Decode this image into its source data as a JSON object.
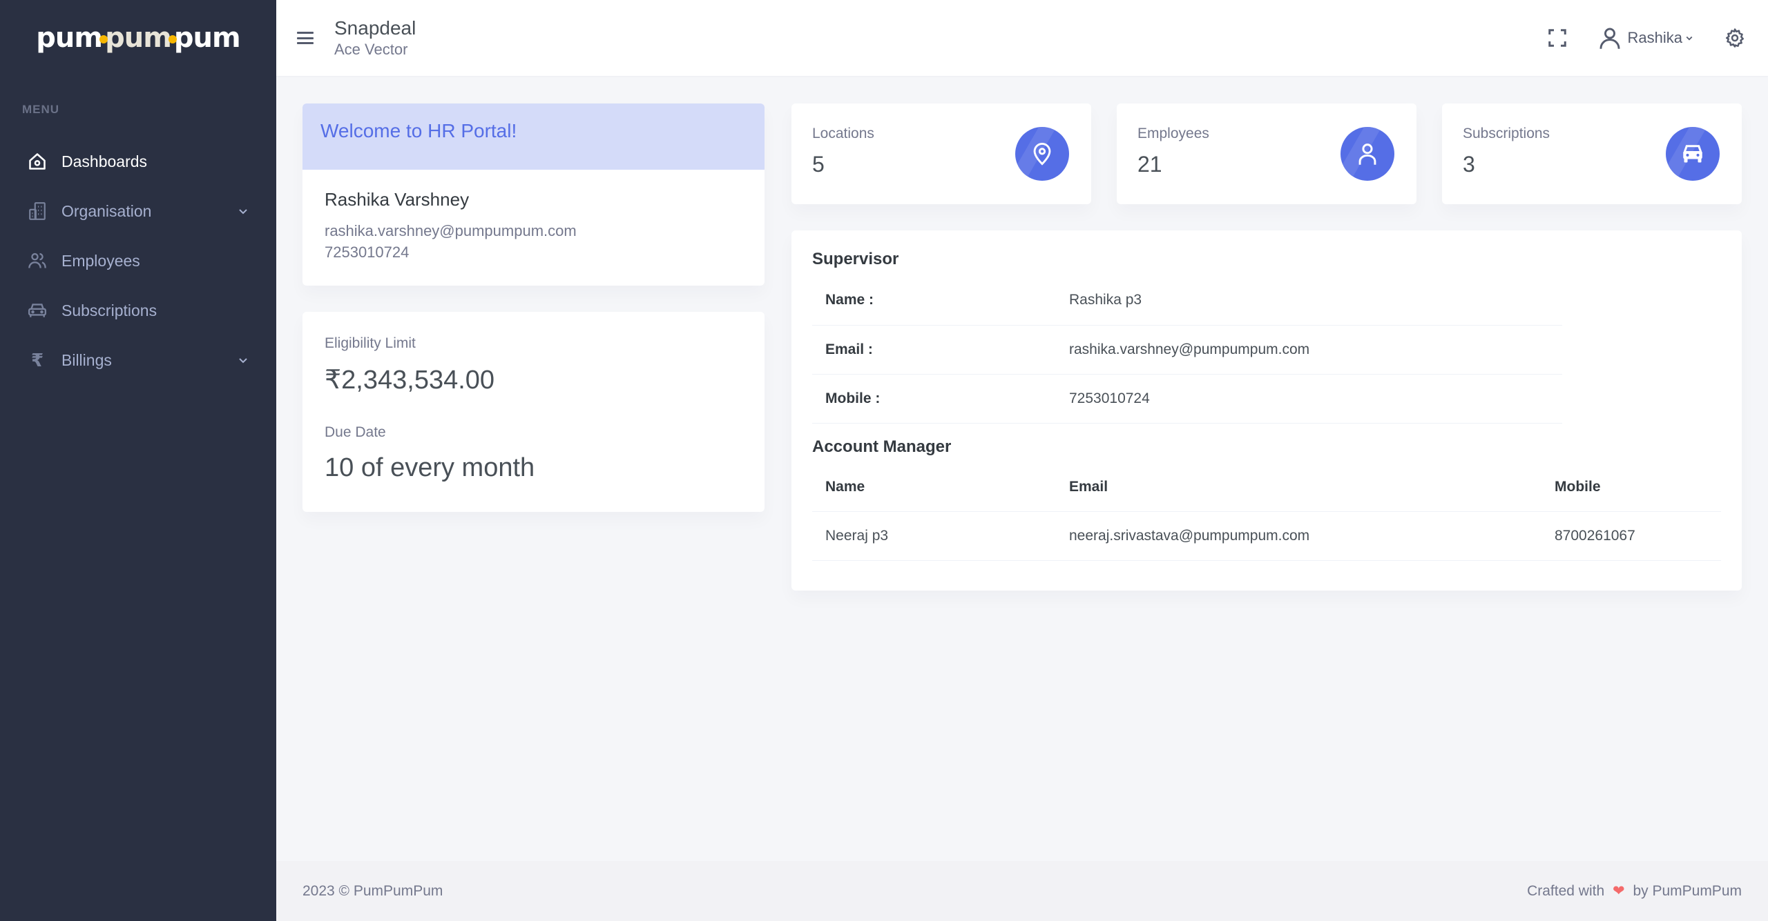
{
  "brand": {
    "logo_text_1": "pum",
    "logo_text_2": "pum",
    "logo_text_3": "pum",
    "accent": "#f6b600"
  },
  "sidebar": {
    "menu_title": "MENU",
    "items": [
      {
        "label": "Dashboards",
        "icon": "home-icon",
        "active": true,
        "has_submenu": false
      },
      {
        "label": "Organisation",
        "icon": "building-icon",
        "active": false,
        "has_submenu": true
      },
      {
        "label": "Employees",
        "icon": "users-icon",
        "active": false,
        "has_submenu": false
      },
      {
        "label": "Subscriptions",
        "icon": "car-icon",
        "active": false,
        "has_submenu": false
      },
      {
        "label": "Billings",
        "icon": "rupee-icon",
        "active": false,
        "has_submenu": true
      }
    ]
  },
  "header": {
    "company_name": "Snapdeal",
    "company_sub": "Ace Vector",
    "user_name": "Rashika"
  },
  "welcome": {
    "title": "Welcome to HR Portal!",
    "name": "Rashika Varshney",
    "email": "rashika.varshney@pumpumpum.com",
    "phone": "7253010724"
  },
  "eligibility": {
    "limit_label": "Eligibility Limit",
    "limit_value": "₹2,343,534.00",
    "due_label": "Due Date",
    "due_value": "10 of every month"
  },
  "stats": [
    {
      "label": "Locations",
      "value": "5",
      "icon": "map-pin-icon"
    },
    {
      "label": "Employees",
      "value": "21",
      "icon": "user-icon"
    },
    {
      "label": "Subscriptions",
      "value": "3",
      "icon": "car-icon"
    }
  ],
  "supervisor": {
    "title": "Supervisor",
    "rows": [
      {
        "key": "Name :",
        "value": "Rashika p3"
      },
      {
        "key": "Email :",
        "value": "rashika.varshney@pumpumpum.com"
      },
      {
        "key": "Mobile :",
        "value": "7253010724"
      }
    ]
  },
  "account_manager": {
    "title": "Account Manager",
    "columns": [
      "Name",
      "Email",
      "Mobile"
    ],
    "rows": [
      [
        "Neeraj p3",
        "neeraj.srivastava@pumpumpum.com",
        "8700261067"
      ]
    ]
  },
  "footer": {
    "left": "2023 © PumPumPum",
    "right_prefix": "Crafted with",
    "heart": "❤",
    "right_suffix": "by PumPumPum"
  },
  "colors": {
    "primary": "#556ee6",
    "sidebar_bg": "#2a3042",
    "banner_bg": "#d4dbf9",
    "heart": "#f46a6a"
  }
}
